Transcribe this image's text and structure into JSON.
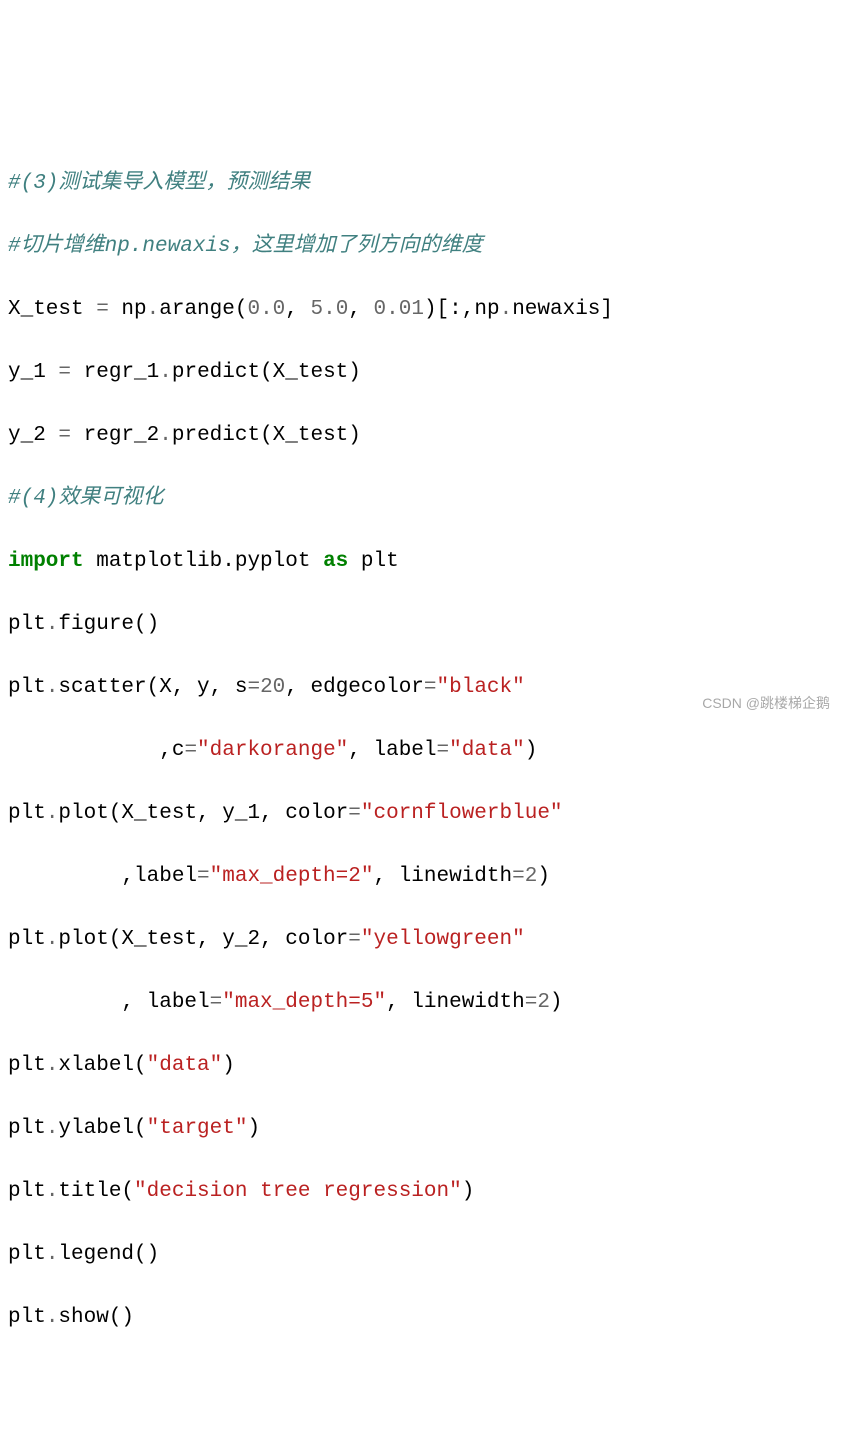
{
  "code": {
    "l1_comment": "#(3)测试集导入模型，预测结果",
    "l2_comment": "#切片增维np.newaxis，这里增加了列方向的维度",
    "l3": {
      "a": "X_test ",
      "op1": "=",
      "b": " np",
      "op2": ".",
      "c": "arange(",
      "n1": "0.0",
      "comma1": ", ",
      "n2": "5.0",
      "comma2": ", ",
      "n3": "0.01",
      "d": ")[:,np",
      "op3": ".",
      "e": "newaxis]"
    },
    "l4": {
      "a": "y_1 ",
      "op1": "=",
      "b": " regr_1",
      "op2": ".",
      "c": "predict(X_test)"
    },
    "l5": {
      "a": "y_2 ",
      "op1": "=",
      "b": " regr_2",
      "op2": ".",
      "c": "predict(X_test)"
    },
    "l6_comment": "#(4)效果可视化",
    "l7": {
      "kw1": "import",
      "a": " matplotlib.pyplot ",
      "kw2": "as",
      "b": " plt"
    },
    "l8": {
      "a": "plt",
      "op": ".",
      "b": "figure()"
    },
    "l9": {
      "a": "plt",
      "op": ".",
      "b": "scatter(X, y, s",
      "op2": "=",
      "n1": "20",
      "c": ", edgecolor",
      "op3": "=",
      "s1": "\"black\""
    },
    "l10": {
      "pad": "            ,c",
      "op1": "=",
      "s1": "\"darkorange\"",
      "c": ", label",
      "op2": "=",
      "s2": "\"data\"",
      "d": ")"
    },
    "l11": {
      "a": "plt",
      "op": ".",
      "b": "plot(X_test, y_1, color",
      "op2": "=",
      "s1": "\"cornflowerblue\""
    },
    "l12": {
      "pad": "         ,label",
      "op1": "=",
      "s1": "\"max_depth=2\"",
      "c": ", linewidth",
      "op2": "=",
      "n1": "2",
      "d": ")"
    },
    "l13": {
      "a": "plt",
      "op": ".",
      "b": "plot(X_test, y_2, color",
      "op2": "=",
      "s1": "\"yellowgreen\""
    },
    "l14": {
      "pad": "         , label",
      "op1": "=",
      "s1": "\"max_depth=5\"",
      "c": ", linewidth",
      "op2": "=",
      "n1": "2",
      "d": ")"
    },
    "l15": {
      "a": "plt",
      "op": ".",
      "b": "xlabel(",
      "s1": "\"data\"",
      "c": ")"
    },
    "l16": {
      "a": "plt",
      "op": ".",
      "b": "ylabel(",
      "s1": "\"target\"",
      "c": ")"
    },
    "l17": {
      "a": "plt",
      "op": ".",
      "b": "title(",
      "s1": "\"decision tree regression\"",
      "c": ")"
    },
    "l18": {
      "a": "plt",
      "op": ".",
      "b": "legend()"
    },
    "l19": {
      "a": "plt",
      "op": ".",
      "b": "show()"
    }
  },
  "watermark": "CSDN @跳楼梯企鹅"
}
